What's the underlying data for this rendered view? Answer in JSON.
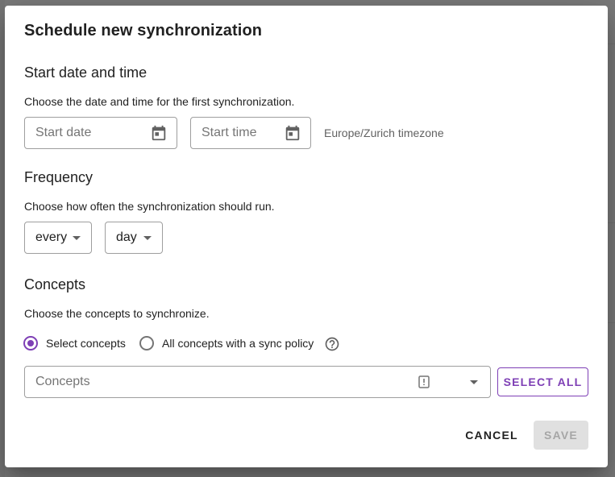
{
  "dialog": {
    "title": "Schedule new synchronization"
  },
  "start": {
    "heading": "Start date and time",
    "description": "Choose the date and time for the first synchronization.",
    "date_placeholder": "Start date",
    "time_placeholder": "Start time",
    "timezone_note": "Europe/Zurich timezone",
    "date_icon": "calendar-icon",
    "time_icon": "calendar-icon"
  },
  "frequency": {
    "heading": "Frequency",
    "description": "Choose how often the synchronization should run.",
    "interval_value": "every",
    "unit_value": "day"
  },
  "concepts": {
    "heading": "Concepts",
    "description": "Choose the concepts to synchronize.",
    "options": [
      {
        "label": "Select concepts",
        "selected": true
      },
      {
        "label": "All concepts with a sync policy",
        "selected": false
      }
    ],
    "help_icon": "help-circle-icon",
    "picker_placeholder": "Concepts",
    "picker_icon": "clipboard-alert-icon",
    "select_all_label": "SELECT ALL"
  },
  "actions": {
    "cancel_label": "CANCEL",
    "save_label": "SAVE",
    "save_enabled": false
  },
  "colors": {
    "accent": "#7e3fb5",
    "disabled_bg": "#e0e0e0",
    "disabled_text": "#a6a6a6",
    "scrim": "#6b6b6b"
  }
}
